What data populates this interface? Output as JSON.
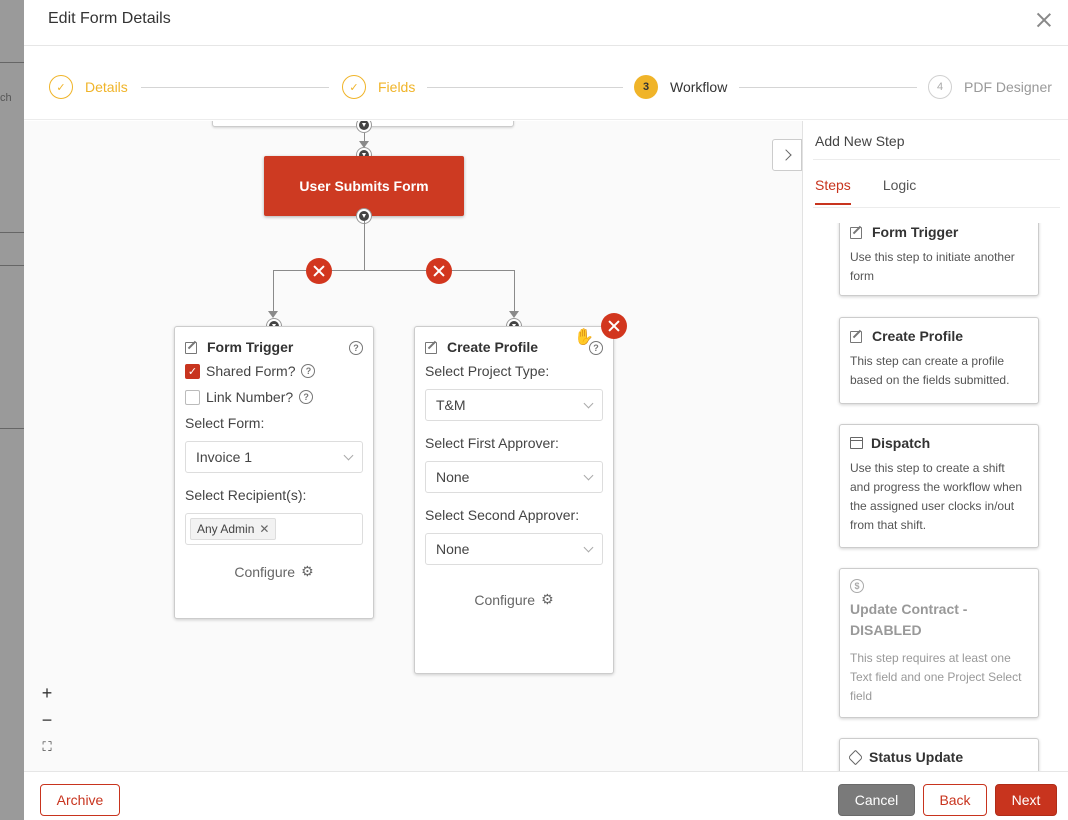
{
  "background": {
    "text": "ch"
  },
  "header": {
    "title": "Edit Form Details"
  },
  "stepper": [
    {
      "num": "✓",
      "label": "Details",
      "state": "done"
    },
    {
      "num": "✓",
      "label": "Fields",
      "state": "done"
    },
    {
      "num": "3",
      "label": "Workflow",
      "state": "active"
    },
    {
      "num": "4",
      "label": "PDF Designer",
      "state": "todo"
    }
  ],
  "canvas": {
    "trigger_node": "User Submits Form",
    "form_trigger": {
      "title": "Form Trigger",
      "shared_form_label": "Shared Form?",
      "shared_form_checked": true,
      "link_number_label": "Link Number?",
      "link_number_checked": false,
      "select_form_label": "Select Form:",
      "select_form_value": "Invoice 1",
      "recipients_label": "Select Recipient(s):",
      "recipient_tag": "Any Admin",
      "configure_label": "Configure"
    },
    "create_profile": {
      "title": "Create Profile",
      "project_type_label": "Select Project Type:",
      "project_type_value": "T&M",
      "first_approver_label": "Select First Approver:",
      "first_approver_value": "None",
      "second_approver_label": "Select Second Approver:",
      "second_approver_value": "None",
      "configure_label": "Configure"
    },
    "zoom": {
      "in": "+",
      "out": "−",
      "fit": "⛶"
    }
  },
  "sidebar": {
    "title": "Add New Step",
    "tabs": [
      "Steps",
      "Logic"
    ],
    "active_tab": "Steps",
    "steps": [
      {
        "title": "Form Trigger",
        "icon": "edit-icon",
        "desc": "Use this step to initiate another form",
        "disabled": false
      },
      {
        "title": "Create Profile",
        "icon": "edit-icon",
        "desc": "This step can create a profile based on the fields submitted.",
        "disabled": false
      },
      {
        "title": "Dispatch",
        "icon": "calendar-icon",
        "desc": "Use this step to create a shift and progress the workflow when the assigned user clocks in/out from that shift.",
        "disabled": false
      },
      {
        "title": "Update Contract - DISABLED",
        "icon": "dollar-icon",
        "desc": "This step requires at least one Text field and one Project Select field",
        "disabled": true
      },
      {
        "title": "Status Update",
        "icon": "tag-icon",
        "desc": "",
        "disabled": false
      }
    ]
  },
  "footer": {
    "archive": "Archive",
    "cancel": "Cancel",
    "back": "Back",
    "next": "Next"
  },
  "colors": {
    "accent": "#c8341e",
    "step_done": "#f0b429"
  }
}
